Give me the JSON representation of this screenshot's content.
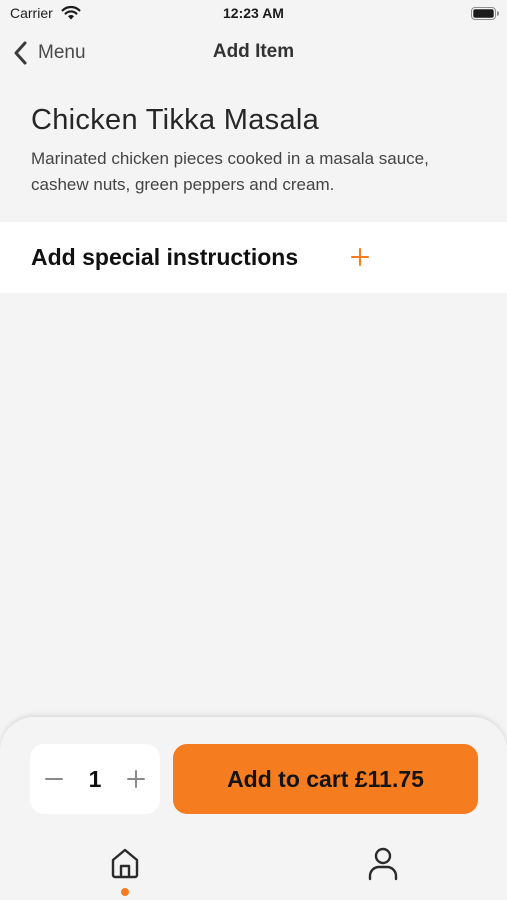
{
  "status_bar": {
    "carrier": "Carrier",
    "time": "12:23 AM",
    "icons": [
      "wifi-icon",
      "battery-icon"
    ]
  },
  "nav": {
    "back_label": "Menu",
    "title": "Add Item",
    "back_icon": "chevron-left-icon"
  },
  "item": {
    "name": "Chicken Tikka Masala",
    "description": "Marinated chicken pieces cooked in a masala sauce, cashew nuts, green peppers and cream."
  },
  "instructions": {
    "label": "Add special instructions",
    "icon": "plus-icon"
  },
  "order": {
    "quantity": "1",
    "add_to_cart_label": "Add to cart £11.75"
  },
  "tab_bar": {
    "items": [
      {
        "icon": "home-icon",
        "active": true
      },
      {
        "icon": "profile-icon",
        "active": false
      }
    ]
  },
  "colors": {
    "accent": "#f57c1f",
    "background": "#f4f4f4",
    "surface": "#ffffff",
    "text": "#1c1c1c"
  }
}
